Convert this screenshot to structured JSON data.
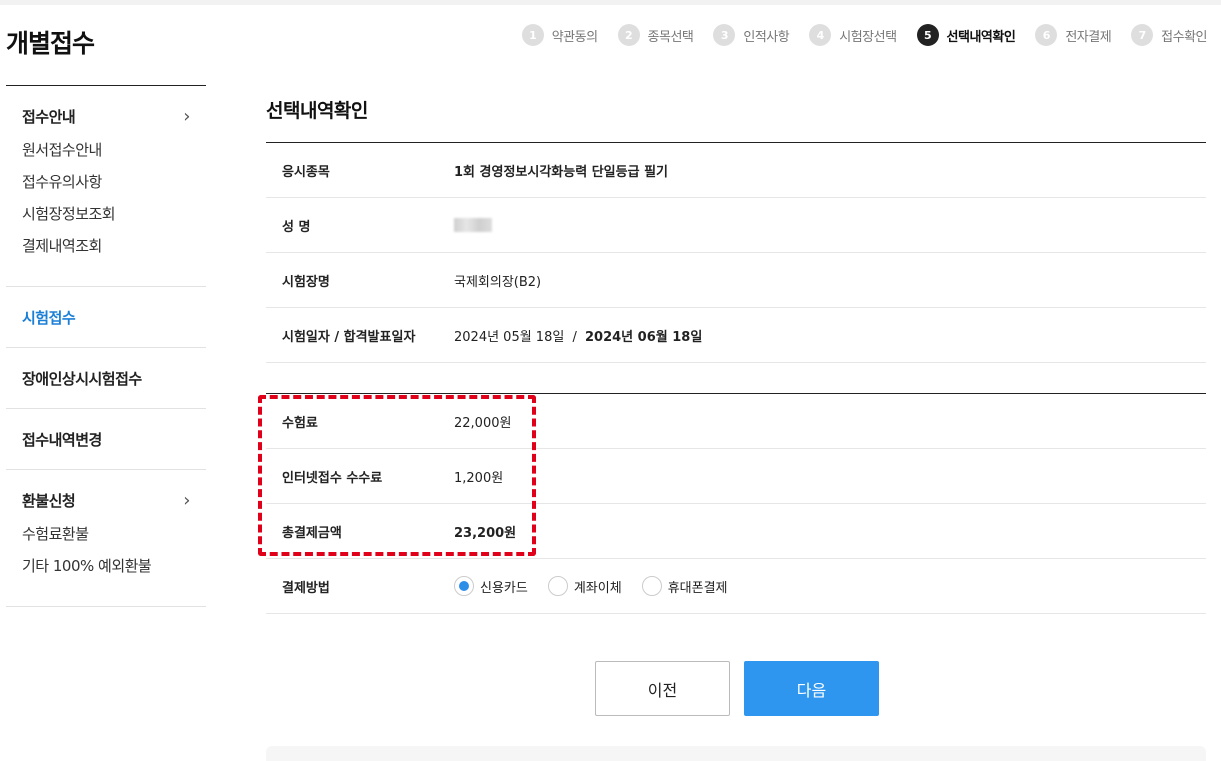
{
  "page_title": "개별접수",
  "steps": [
    {
      "num": "1",
      "label": "약관동의",
      "active": false
    },
    {
      "num": "2",
      "label": "종목선택",
      "active": false
    },
    {
      "num": "3",
      "label": "인적사항",
      "active": false
    },
    {
      "num": "4",
      "label": "시험장선택",
      "active": false
    },
    {
      "num": "5",
      "label": "선택내역확인",
      "active": true
    },
    {
      "num": "6",
      "label": "전자결제",
      "active": false
    },
    {
      "num": "7",
      "label": "접수확인",
      "active": false
    }
  ],
  "sidebar": {
    "sections": [
      {
        "label": "접수안내",
        "chevron": "›",
        "items": [
          "원서접수안내",
          "접수유의사항",
          "시험장정보조회",
          "결제내역조회"
        ]
      },
      {
        "label": "시험접수",
        "active": true
      },
      {
        "label": "장애인상시시험접수"
      },
      {
        "label": "접수내역변경"
      },
      {
        "label": "환불신청",
        "chevron": "›",
        "items": [
          "수험료환불",
          "기타 100% 예외환불"
        ]
      }
    ]
  },
  "main": {
    "title": "선택내역확인",
    "info": {
      "exam_type_label": "응시종목",
      "exam_type_value": "1회 경영정보시각화능력 단일등급 필기",
      "name_label": "성 명",
      "venue_label": "시험장명",
      "venue_value": "국제회의장(B2)",
      "dates_label": "시험일자 / 합격발표일자",
      "exam_date": "2024년 05월 18일",
      "date_separator": "/",
      "result_date": "2024년 06월 18일"
    },
    "fees": {
      "exam_fee_label": "수험료",
      "exam_fee_value": "22,000원",
      "internet_fee_label": "인터넷접수 수수료",
      "internet_fee_value": "1,200원",
      "total_label": "총결제금액",
      "total_value": "23,200원",
      "payment_label": "결제방법",
      "payment_options": [
        {
          "label": "신용카드",
          "checked": true
        },
        {
          "label": "계좌이체",
          "checked": false
        },
        {
          "label": "휴대폰결제",
          "checked": false
        }
      ]
    },
    "buttons": {
      "prev": "이전",
      "next": "다음"
    }
  },
  "colors": {
    "accent": "#2f96f0",
    "highlight": "#e0001a",
    "active_sidebar": "#1a7fd6"
  }
}
